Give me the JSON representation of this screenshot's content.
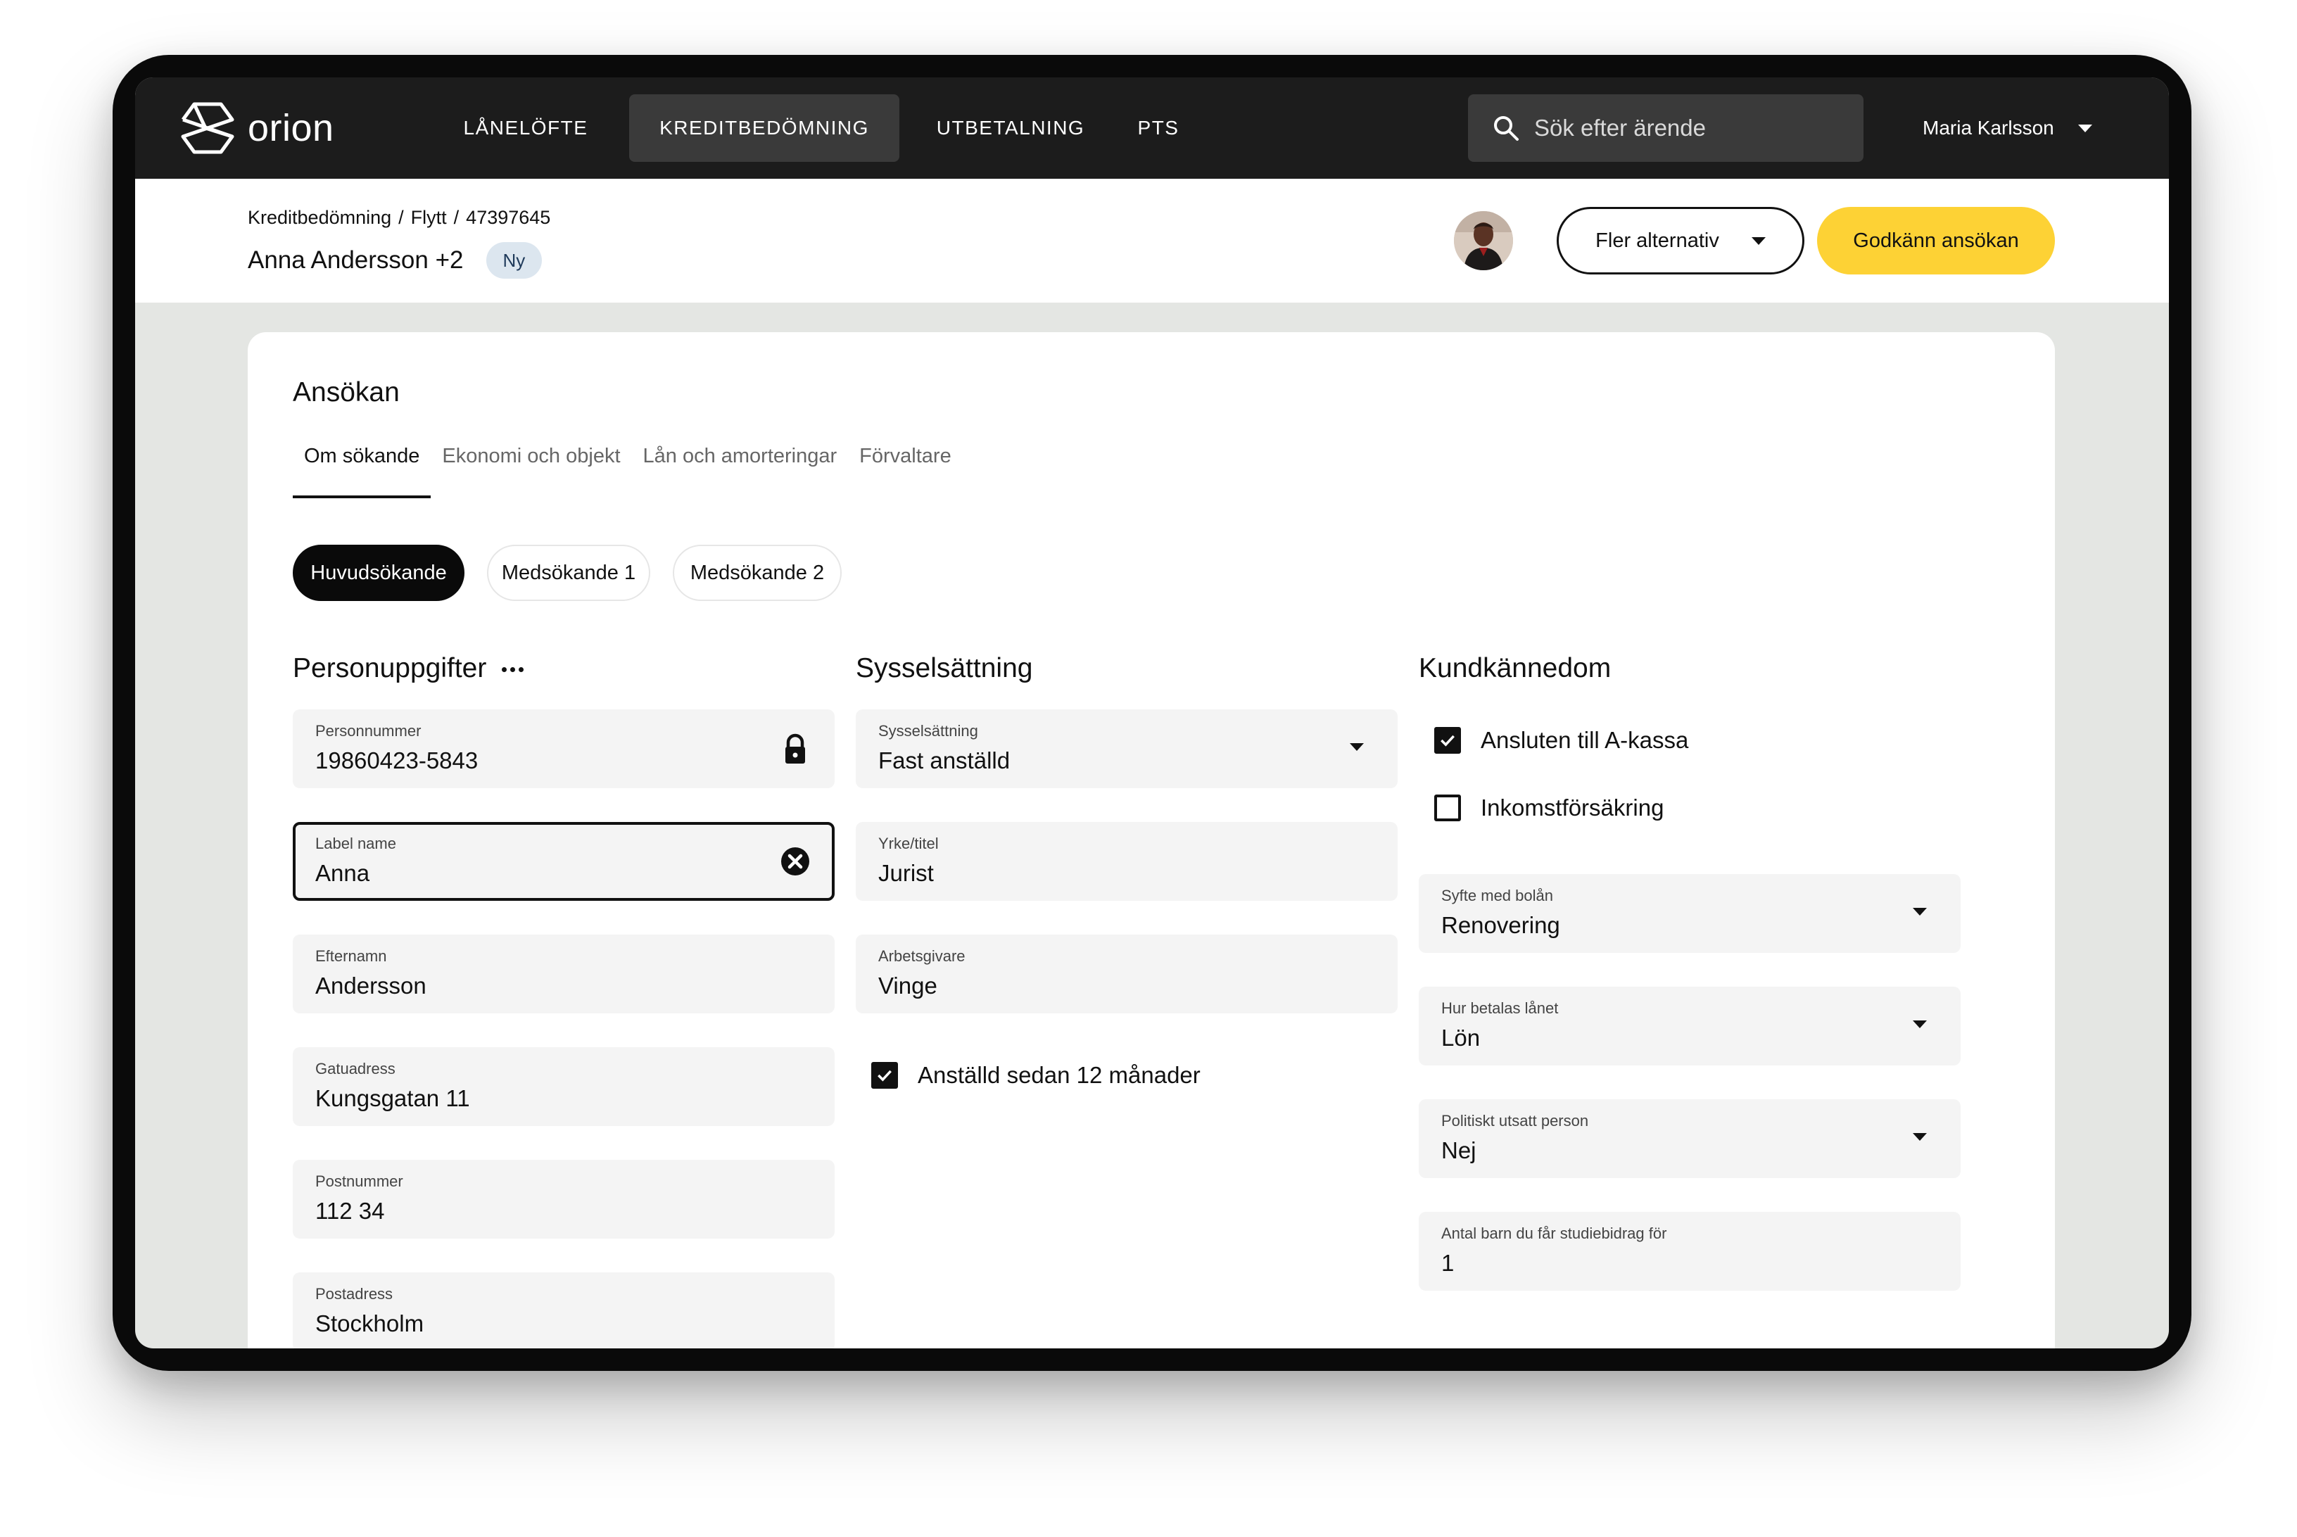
{
  "app": {
    "logo_text": "orion",
    "nav": [
      {
        "label": "LÅNELÖFTE",
        "active": false
      },
      {
        "label": "KREDITBEDÖMNING",
        "active": true
      },
      {
        "label": "UTBETALNING",
        "active": false
      },
      {
        "label": "PTS",
        "active": false
      }
    ],
    "search": {
      "placeholder": "Sök efter ärende",
      "icon": "search-icon"
    },
    "user": {
      "name": "Maria Karlsson",
      "icon": "chevron-down-icon"
    }
  },
  "subheader": {
    "breadcrumb": [
      "Kreditbedömning",
      "Flytt",
      "47397645"
    ],
    "breadcrumb_separator": "/",
    "applicant_name": "Anna Andersson +2",
    "status_badge": "Ny",
    "more_options_label": "Fler alternativ",
    "approve_label": "Godkänn ansökan"
  },
  "colors": {
    "nav_bg": "#1c1c1c",
    "nav_active_bg": "#3a3a3a",
    "page_bg": "#e4e6e3",
    "primary_button": "#fdd235",
    "badge_bg": "#dce6ef",
    "field_bg": "#f4f4f4"
  },
  "card": {
    "title": "Ansökan",
    "tabs": [
      {
        "label": "Om sökande",
        "active": true
      },
      {
        "label": "Ekonomi och objekt",
        "active": false
      },
      {
        "label": "Lån och amorteringar",
        "active": false
      },
      {
        "label": "Förvaltare",
        "active": false
      }
    ],
    "applicant_pills": [
      {
        "label": "Huvudsökande",
        "active": true
      },
      {
        "label": "Medsökande 1",
        "active": false
      },
      {
        "label": "Medsökande 2",
        "active": false
      }
    ]
  },
  "personal": {
    "title": "Personuppgifter",
    "fields": [
      {
        "label": "Personnummer",
        "value": "19860423-5843",
        "icon": "lock-icon"
      },
      {
        "label": "Label name",
        "value": "Anna",
        "icon": "clear-icon",
        "focused": true
      },
      {
        "label": "Efternamn",
        "value": "Andersson"
      },
      {
        "label": "Gatuadress",
        "value": "Kungsgatan 11"
      },
      {
        "label": "Postnummer",
        "value": "112 34"
      },
      {
        "label": "Postadress",
        "value": "Stockholm"
      }
    ]
  },
  "employment": {
    "title": "Sysselsättning",
    "fields": [
      {
        "label": "Sysselsättning",
        "value": "Fast anställd",
        "type": "select"
      },
      {
        "label": "Yrke/titel",
        "value": "Jurist"
      },
      {
        "label": "Arbetsgivare",
        "value": "Vinge"
      }
    ],
    "employed_12_months": {
      "label": "Anställd sedan 12 månader",
      "checked": true
    }
  },
  "kyc": {
    "title": "Kundkännedom",
    "checkboxes": [
      {
        "label": "Ansluten till A-kassa",
        "checked": true
      },
      {
        "label": "Inkomstförsäkring",
        "checked": false
      }
    ],
    "fields": [
      {
        "label": "Syfte med bolån",
        "value": "Renovering",
        "type": "select"
      },
      {
        "label": "Hur betalas lånet",
        "value": "Lön",
        "type": "select"
      },
      {
        "label": "Politiskt utsatt person",
        "value": "Nej",
        "type": "select"
      },
      {
        "label": "Antal barn du får studiebidrag för",
        "value": "1"
      }
    ]
  }
}
